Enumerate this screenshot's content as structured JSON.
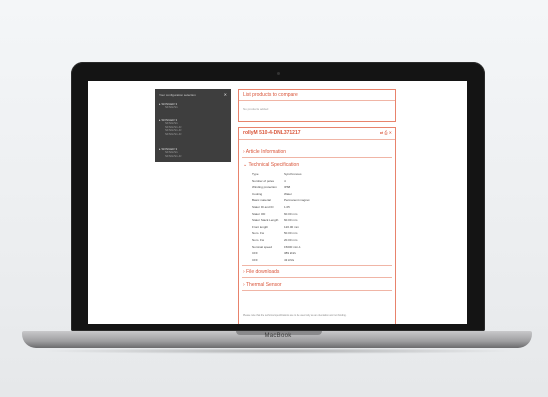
{
  "device": {
    "brand": "MacBook"
  },
  "sidebar": {
    "title": "Your configuration selection",
    "close_icon": "close-icon",
    "groups": [
      {
        "label": "SFINGER 3",
        "items": [
          "SFNG/S1"
        ]
      },
      {
        "label": "SFINGER 3",
        "items": [
          "SFNG/S1",
          "SFNG/S1-Fr",
          "SFNG/S1-Fr",
          "SFNG/S1-Fr"
        ]
      },
      {
        "label": "SFINGER 3",
        "items": [
          "SFNG/S1",
          "SFNG/S1-Fr"
        ]
      }
    ]
  },
  "compare": {
    "title": "List products to compare",
    "empty_text": "No products added"
  },
  "product": {
    "title": "rollyM 510-4-DNL371217",
    "icons": [
      "compare-icon",
      "print-icon",
      "close-icon"
    ],
    "sections": {
      "article_info": "Article Information",
      "tech_spec": "Technical Specification",
      "file_downloads": "File downloads",
      "thermal_sensor": "Thermal Sensor"
    },
    "specs": [
      {
        "label": "Type",
        "value": "Synchronous"
      },
      {
        "label": "Number of poles",
        "value": "4"
      },
      {
        "label": "Winding protection",
        "value": "IP68"
      },
      {
        "label": "Cooling",
        "value": "Water"
      },
      {
        "label": "Basic material",
        "value": "Permanent magnet"
      },
      {
        "label": "Stator ID and ID",
        "value": "1.05"
      },
      {
        "label": "Stator OD",
        "value": "60.00 mm"
      },
      {
        "label": "Stator Stack Length",
        "value": "60.00 mm"
      },
      {
        "label": "Front length",
        "value": "120.00 mm"
      },
      {
        "label": "Nom. Fw",
        "value": "50.00 mm"
      },
      {
        "label": "Nom. Fw",
        "value": "20.00 mm"
      },
      {
        "label": "Nominal speed",
        "value": "15000 min-1"
      },
      {
        "label": "CFF",
        "value": "389 kN/s"
      },
      {
        "label": "CFF",
        "value": "43 kN/s"
      }
    ],
    "footer_note": "Please note that the technical specifications are to be used only as an orientation and not binding."
  }
}
